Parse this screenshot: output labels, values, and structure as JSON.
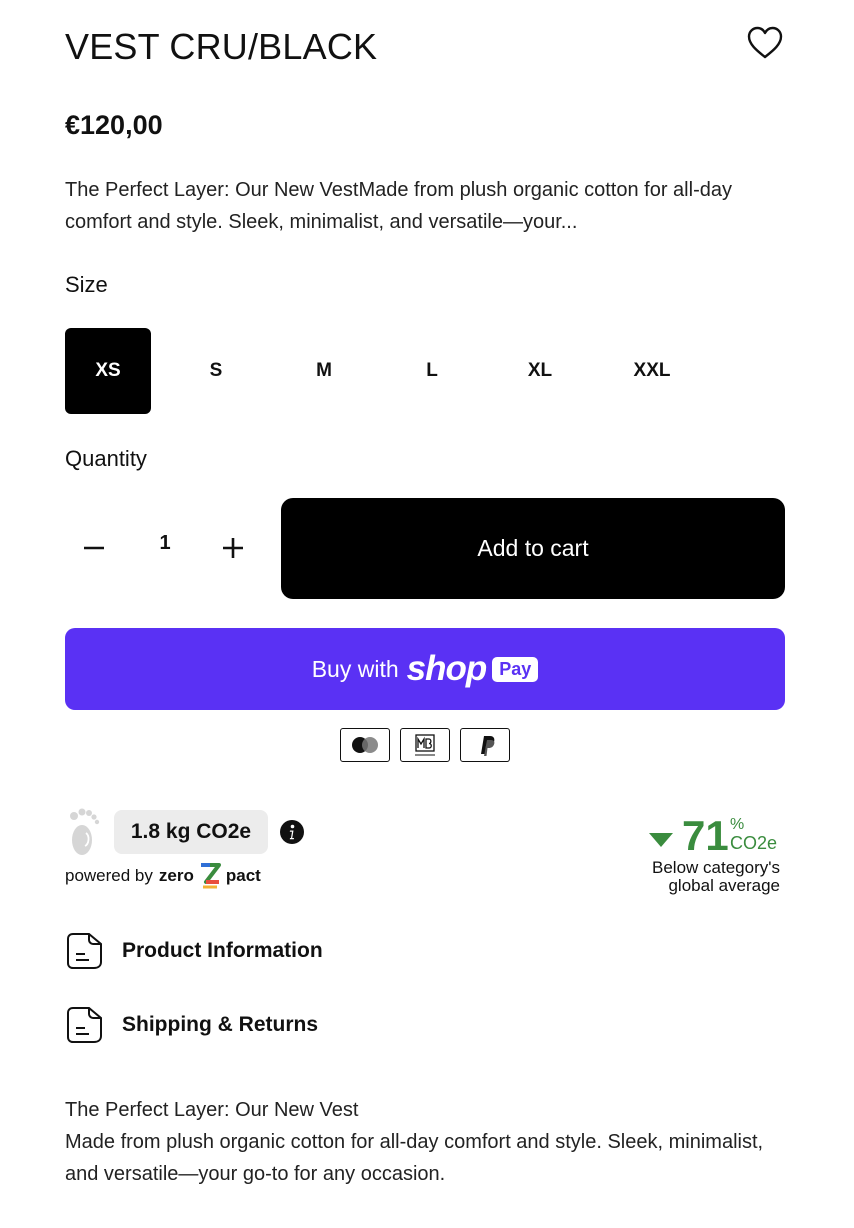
{
  "product": {
    "title": "VEST CRU/BLACK",
    "price": "€120,00",
    "excerpt": "The Perfect Layer: Our New VestMade from plush organic cotton for all-day comfort and style. Sleek, minimalist, and versatile—your..."
  },
  "size": {
    "label": "Size",
    "options": [
      "XS",
      "S",
      "M",
      "L",
      "XL",
      "XXL"
    ],
    "selected": "XS"
  },
  "quantity": {
    "label": "Quantity",
    "value": "1"
  },
  "actions": {
    "add_to_cart": "Add to cart",
    "buy_with": "Buy with",
    "shop_word": "shop",
    "pay_badge": "Pay"
  },
  "payment_icons": [
    "mastercard-icon",
    "multibanco-icon",
    "paypal-icon"
  ],
  "carbon": {
    "value": "1.8 kg CO2e",
    "powered_by": "powered by",
    "brand_zero": "zero",
    "brand_pact": "pact",
    "reduction_value": "71",
    "reduction_percent": "%",
    "reduction_unit": "CO2e",
    "reduction_line1": "Below category's",
    "reduction_line2": "global average",
    "accent_color": "#3a8c3e"
  },
  "accordions": [
    {
      "label": "Product Information"
    },
    {
      "label": "Shipping & Returns"
    }
  ],
  "description": {
    "line1": "The Perfect Layer: Our New Vest",
    "line2": "Made from plush organic cotton for all-day comfort and style. Sleek, minimalist, and versatile—your go-to for any occasion."
  },
  "colors": {
    "shop_pay": "#5a31f4",
    "primary": "#000000"
  }
}
